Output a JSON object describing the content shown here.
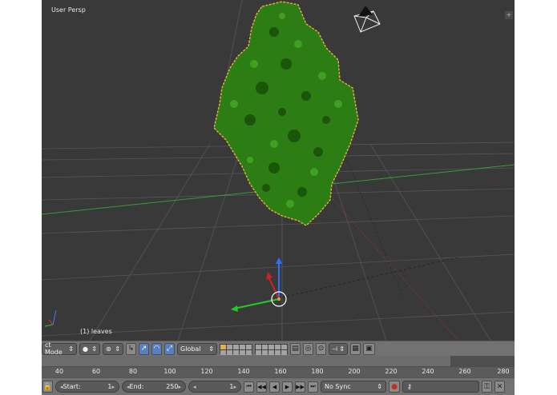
{
  "viewport": {
    "view_label": "User Persp",
    "object_label": "(1) leaves",
    "grid_color": "#5a5a5a",
    "background": "#393939",
    "x_axis_color": "#b03a3a",
    "y_axis_color": "#3a9a3a",
    "foliage_color": "#2e8a1a",
    "selection_outline_color": "#e8b040",
    "widget_icons": [
      "camera-icon",
      "transform-manipulator-icon",
      "3d-cursor-icon",
      "axis-gizmo-icon"
    ]
  },
  "header": {
    "mode_select": {
      "value": "ct Mode",
      "icon": "updown-arrow-icon"
    },
    "shading_icon": "solid-sphere-icon",
    "pivot_icon": "pivot-point-icon",
    "manipulator_icons": [
      "translate-icon",
      "rotate-icon",
      "scale-icon"
    ],
    "orientation_select": {
      "value": "Global"
    },
    "layers_active_index": 0,
    "extra_icons": [
      "proportional-edit-icon",
      "snap-icon",
      "render-icon",
      "camera-render-icon"
    ]
  },
  "timeline": {
    "ticks": [
      "40",
      "60",
      "80",
      "100",
      "120",
      "140",
      "160",
      "180",
      "200",
      "220",
      "240",
      "260",
      "280"
    ]
  },
  "playback": {
    "start_label": "Start:",
    "start_value": "1",
    "end_label": "End:",
    "end_value": "250",
    "current_frame": "1",
    "sync_value": "No Sync",
    "controls": [
      "jump-start-icon",
      "prev-keyframe-icon",
      "play-reverse-icon",
      "play-icon",
      "next-keyframe-icon",
      "jump-end-icon"
    ],
    "record_icon": "record-icon",
    "keying_icon": "key-icon"
  }
}
